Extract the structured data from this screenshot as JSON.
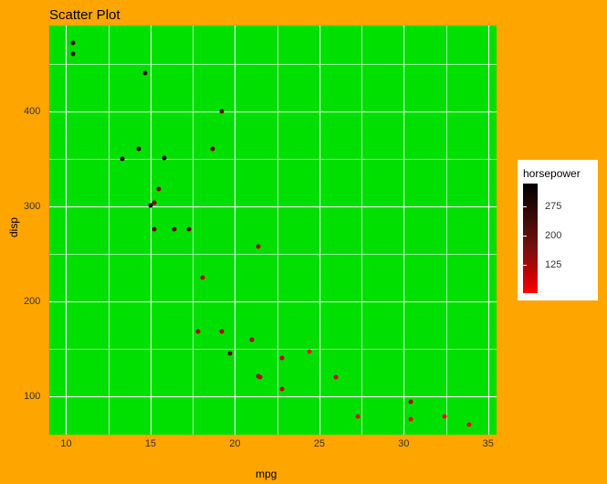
{
  "chart_data": {
    "type": "scatter",
    "title": "Scatter Plot",
    "xlabel": "mpg",
    "ylabel": "disp",
    "xlim": [
      9,
      35.5
    ],
    "ylim": [
      60,
      490
    ],
    "xticks": [
      10,
      15,
      20,
      25,
      30,
      35
    ],
    "yticks": [
      100,
      200,
      300,
      400
    ],
    "x": [
      21.0,
      21.0,
      22.8,
      21.4,
      18.7,
      18.1,
      14.3,
      24.4,
      22.8,
      19.2,
      17.8,
      16.4,
      17.3,
      15.2,
      10.4,
      10.4,
      14.7,
      32.4,
      30.4,
      33.9,
      21.5,
      15.5,
      15.2,
      13.3,
      19.2,
      27.3,
      26.0,
      30.4,
      15.8,
      19.7,
      15.0,
      21.4
    ],
    "y": [
      160,
      160,
      108,
      258,
      360,
      225,
      360,
      147,
      141,
      168,
      168,
      276,
      276,
      276,
      472,
      460,
      440,
      79,
      76,
      71,
      120,
      318,
      304,
      350,
      400,
      79,
      120,
      95,
      351,
      145,
      301,
      121
    ],
    "color": [
      110,
      110,
      93,
      110,
      175,
      105,
      245,
      62,
      95,
      123,
      123,
      180,
      180,
      180,
      205,
      215,
      230,
      66,
      52,
      65,
      97,
      150,
      150,
      245,
      175,
      66,
      91,
      113,
      264,
      175,
      335,
      109
    ],
    "color_label": "horsepower",
    "color_ticks": [
      125,
      200,
      275
    ],
    "color_range": [
      52,
      335
    ]
  },
  "colors": {
    "panel_bg": "#00e000",
    "plot_bg": "#ffa500",
    "low": "#ff0000",
    "high": "#000000"
  }
}
